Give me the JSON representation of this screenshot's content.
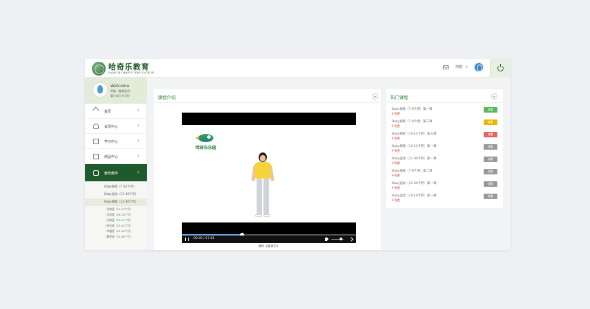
{
  "header": {
    "logo_cn": "哈奇乐教育",
    "logo_en": "HAACHI HAPPY EDUCATION",
    "user_name": "阿勒",
    "caret": "▾"
  },
  "sidebar": {
    "welcome_title": "Welcome",
    "user_line": "阿勒（普通会员）",
    "age_line": "婴小学习 0-3岁",
    "nav": [
      {
        "label": "首页",
        "icon": "home-icon"
      },
      {
        "label": "会员中心",
        "icon": "user-icon"
      },
      {
        "label": "学习中心",
        "icon": "book-icon"
      },
      {
        "label": "商品中心",
        "icon": "bag-icon"
      },
      {
        "label": "教育教学",
        "icon": "edit-icon",
        "active": true
      }
    ],
    "chevron": "›",
    "sub_items": [
      {
        "label": "Baby探索（7-12个月）"
      },
      {
        "label": "Baby运动（13-36个月）"
      },
      {
        "label": "Baby探索（13-36个月）",
        "selected": true
      }
    ],
    "sub_children": [
      {
        "label": "· 月龄班（13-15个月）"
      },
      {
        "label": "· 月龄班（16-18个月）"
      },
      {
        "label": "· 大龄班（19-21个月）",
        "current": true
      },
      {
        "label": "· 阳光班（22-24个月）"
      },
      {
        "label": "· 幸福班（25-30个月）"
      },
      {
        "label": "· 繁荣班（31-36个月）"
      }
    ]
  },
  "intro": {
    "title": "课程介绍",
    "video": {
      "logo_text": "哈奇乐乐园",
      "time": "00:40 / 01:56",
      "progress": 0.345,
      "volume": 0.75
    },
    "caption": "课件《集体学》"
  },
  "hot": {
    "title": "热门课程",
    "items": [
      {
        "name": "Baby探索（7-9个月）第一课",
        "price": "¥ 免费",
        "btn": "查看",
        "color": "#5cb85c"
      },
      {
        "name": "Baby探索（7-9个月）第三课",
        "price": "¥ 免费",
        "btn": "查看",
        "color": "#f0b400"
      },
      {
        "name": "Baby探索（10-12个月）第三课",
        "price": "¥ 免费",
        "btn": "查看",
        "color": "#e06666"
      },
      {
        "name": "Baby探索（10-12个月）第一课",
        "price": "¥ 免费",
        "btn": "查看",
        "color": "#999999"
      },
      {
        "name": "Baby运动（31-36个月）第一课",
        "price": "¥ 免费",
        "btn": "查看",
        "color": "#999999"
      },
      {
        "name": "Baby探索（7-9个月）第二课",
        "price": "¥ 免费",
        "btn": "查看",
        "color": "#999999"
      },
      {
        "name": "Baby运动（22-24个月）第一课",
        "price": "¥ 免费",
        "btn": "查看",
        "color": "#999999"
      },
      {
        "name": "Baby运动（16-18个月）第一课",
        "price": "¥ 免费",
        "btn": "查看",
        "color": "#999999"
      }
    ]
  },
  "colors": {
    "brand_green": "#1f5a2c",
    "title_green": "#2f7f3a",
    "price_red": "#dd3333"
  }
}
